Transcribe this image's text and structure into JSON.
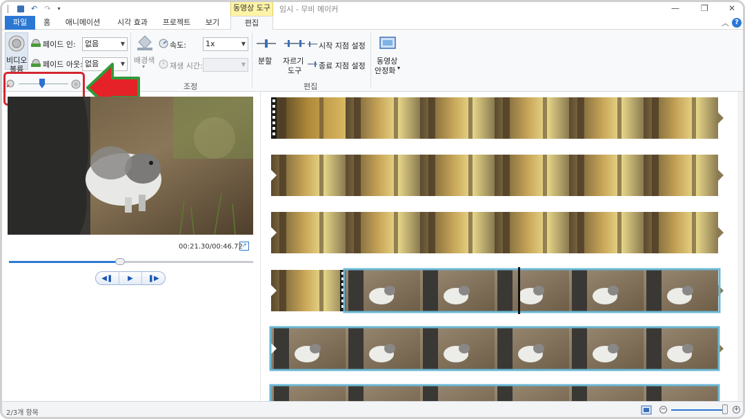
{
  "window": {
    "title": "임시 - 무비 메이커",
    "context_tab": "동영상 도구"
  },
  "tabs": [
    "파일",
    "홈",
    "애니메이션",
    "시각 효과",
    "프로젝트",
    "보기",
    "편집"
  ],
  "ribbon": {
    "audio": {
      "volume_label": "비디오 볼륨",
      "volume_line1": "비디오",
      "volume_line2": "볼륨",
      "fade_in_label": "페이드 인:",
      "fade_in_value": "없음",
      "fade_out_label": "페이드 아웃:",
      "fade_out_value": "없음"
    },
    "adjust": {
      "background_label": "배경색",
      "speed_label": "속도:",
      "speed_value": "1x",
      "duration_label": "재생 시간:",
      "duration_value": "",
      "group_label": "조정"
    },
    "edit": {
      "split_label": "분할",
      "trim_line1": "자르기",
      "trim_line2": "도구",
      "set_start": "시작 지점 설정",
      "set_end": "종료 지점 설정",
      "group_label": "편집"
    },
    "stabilize": {
      "line1": "동영상",
      "line2": "안정화"
    }
  },
  "preview": {
    "time": "00:21.30/00:46.72",
    "progress": 0.455
  },
  "status": {
    "items_text": "2/3개 항목"
  },
  "zoom": {
    "level": 0.95
  },
  "colors": {
    "accent": "#2b78d4",
    "highlight_box": "#d32630",
    "arrow_fill": "#e52228",
    "arrow_border": "#2f9b3a",
    "context_tab": "#fff3a6",
    "selected_clip_border": "#6ab7d4"
  }
}
